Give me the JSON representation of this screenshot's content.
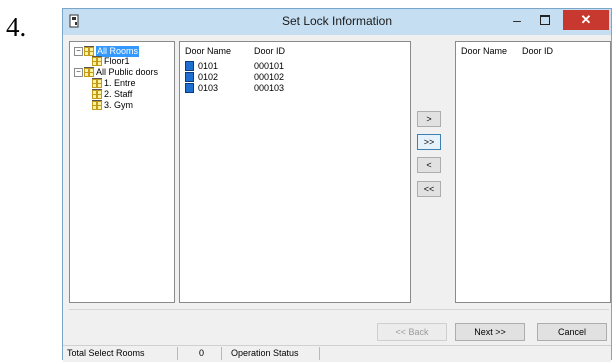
{
  "step_number": "4.",
  "window": {
    "title": "Set Lock Information",
    "minimize_glyph": "–",
    "close_glyph": "✕"
  },
  "tree": {
    "nodes": [
      {
        "label": "All Rooms",
        "expander": "⊟",
        "selected": true
      },
      {
        "label": "Floor1"
      },
      {
        "label": "All Public doors",
        "expander": "⊟"
      },
      {
        "label": "1. Entre"
      },
      {
        "label": "2. Staff"
      },
      {
        "label": "3. Gym"
      }
    ]
  },
  "door_list": {
    "columns": [
      "Door Name",
      "Door ID"
    ],
    "rows": [
      {
        "name": "0101",
        "id": "000101"
      },
      {
        "name": "0102",
        "id": "000102"
      },
      {
        "name": "0103",
        "id": "000103"
      }
    ]
  },
  "selected_list": {
    "columns": [
      "Door Name",
      "Door ID"
    ],
    "rows": []
  },
  "move_buttons": [
    {
      "label": ">"
    },
    {
      "label": ">>"
    },
    {
      "label": "<"
    },
    {
      "label": "<<"
    }
  ],
  "footer": {
    "back_label": "<< Back",
    "next_label": "Next >>",
    "cancel_label": "Cancel"
  },
  "status": {
    "total_label": "Total Select Rooms",
    "total_value": "0",
    "operation_label": "Operation Status"
  },
  "colors": {
    "titlebar": "#c5def1",
    "close": "#c7392e",
    "selection": "#3399ff",
    "door_icon": "#1e6fd0"
  },
  "icons": [
    "app-lock-icon",
    "building-icon",
    "door-icon"
  ]
}
